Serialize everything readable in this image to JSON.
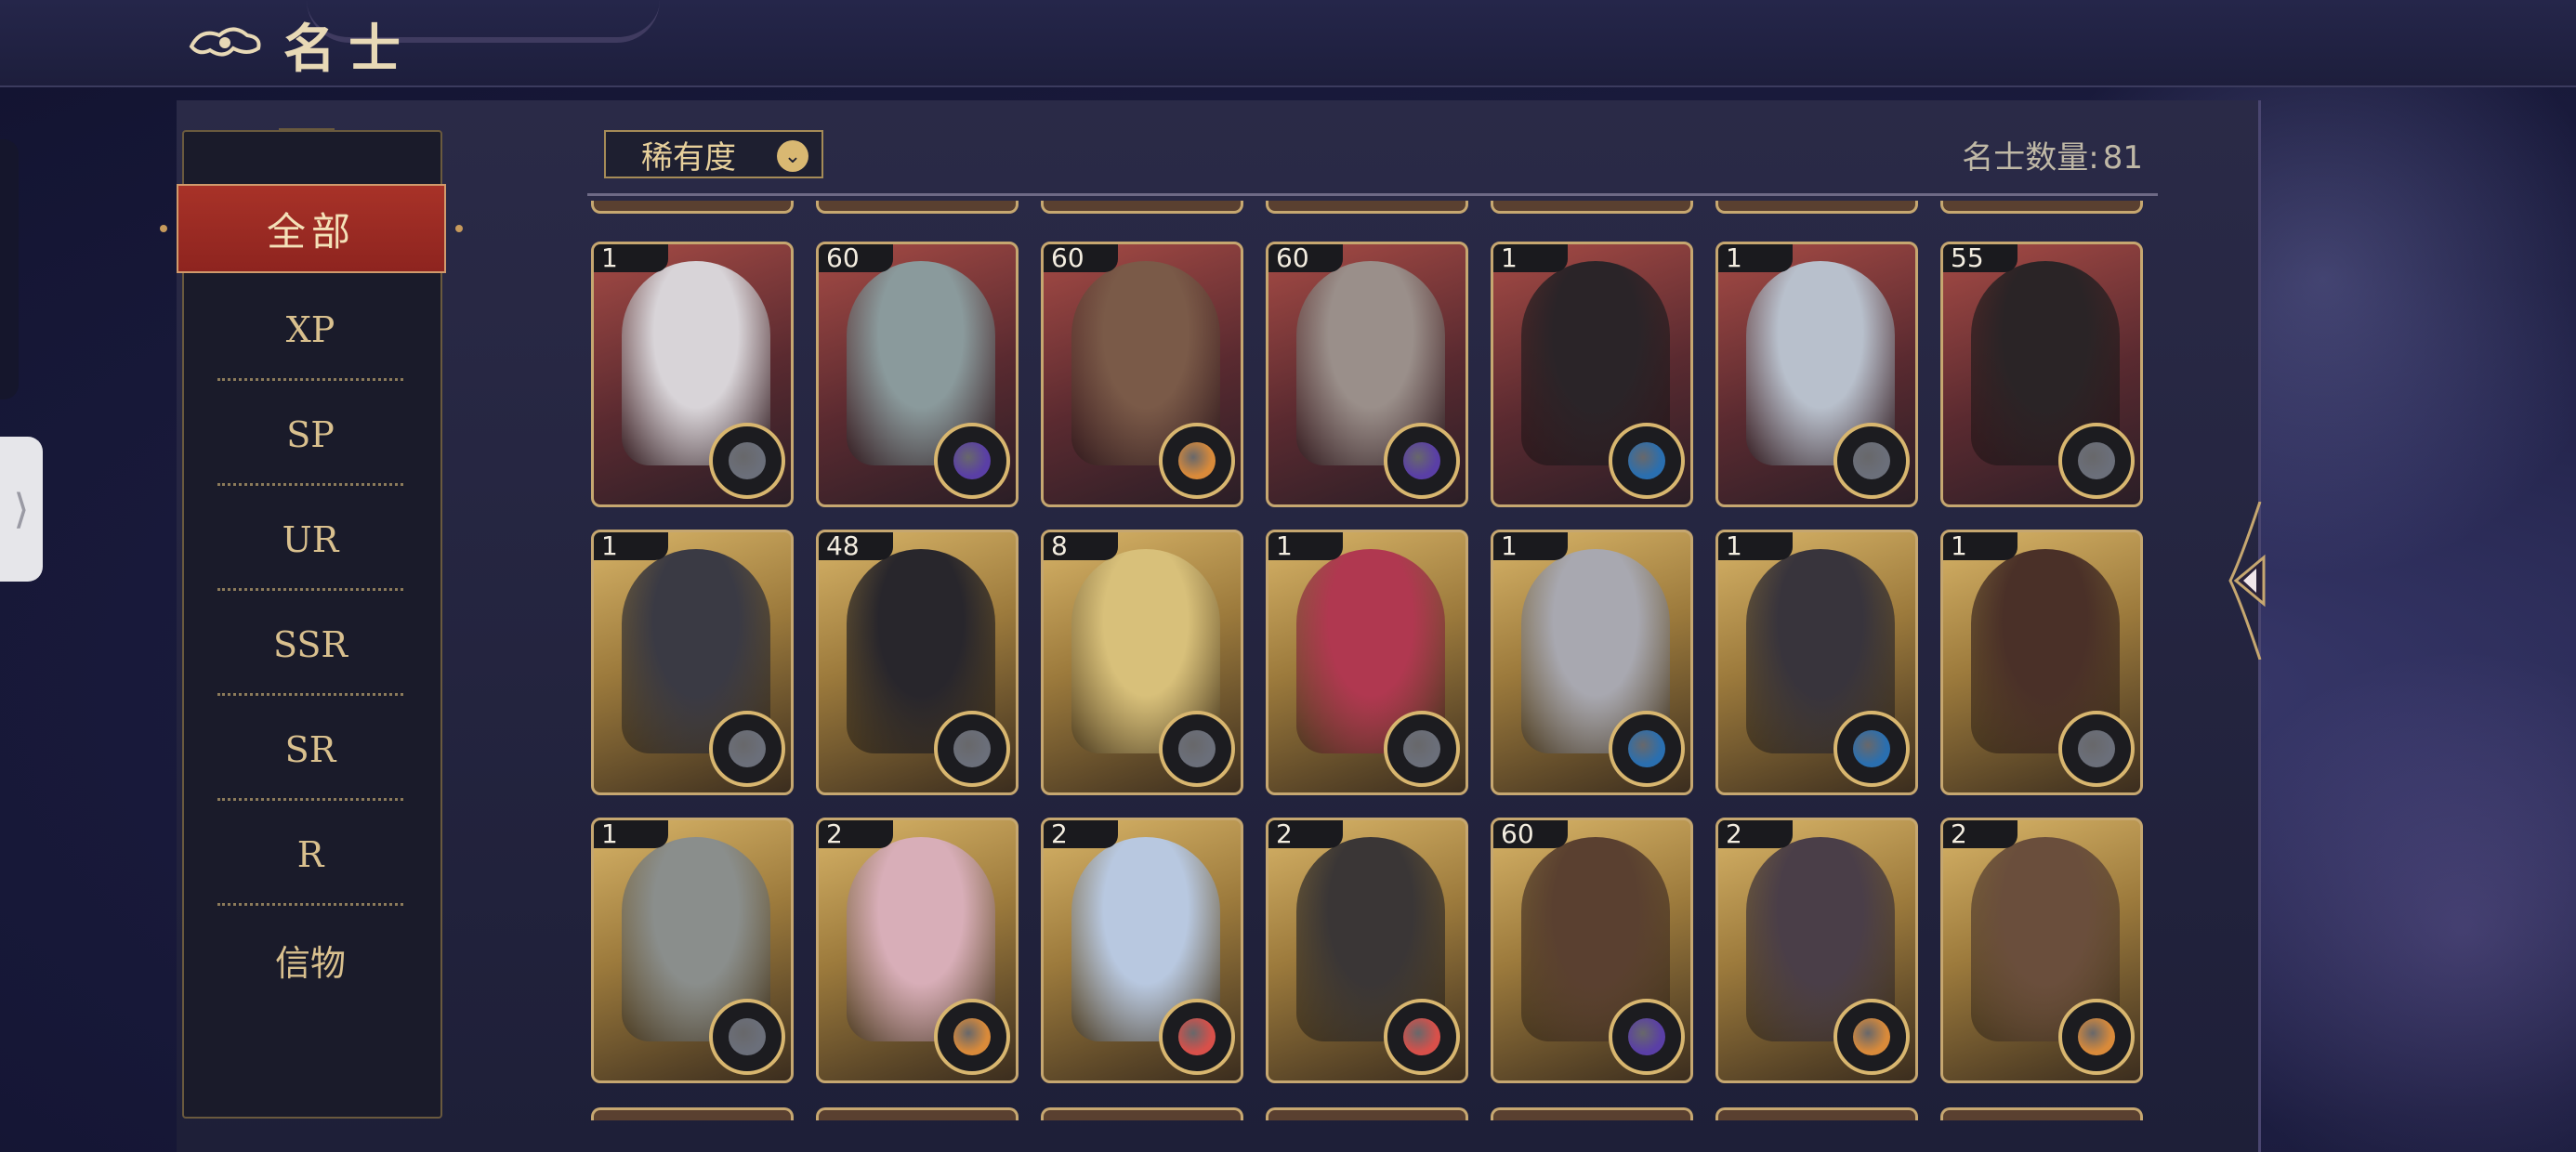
{
  "title": "名士",
  "sidebar": {
    "active": "全部",
    "items": [
      "XP",
      "SP",
      "UR",
      "SSR",
      "SR",
      "R",
      "信物"
    ]
  },
  "sort": {
    "label": "稀有度"
  },
  "count": {
    "label": "名士数量:",
    "value": "81"
  },
  "colors": {
    "accent": "#a83228",
    "gold": "#c6a770",
    "panel": "#1a1b2a"
  },
  "cards": [
    {
      "level": "1",
      "frame": "red",
      "element": "grey",
      "color": "#6b6f7a"
    },
    {
      "level": "60",
      "frame": "red",
      "element": "purple",
      "color": "#5a3fa6"
    },
    {
      "level": "60",
      "frame": "red",
      "element": "orange",
      "color": "#d98a3a"
    },
    {
      "level": "60",
      "frame": "red",
      "element": "purple",
      "color": "#5a3fa6"
    },
    {
      "level": "1",
      "frame": "red",
      "element": "blue",
      "color": "#2a6fb0"
    },
    {
      "level": "1",
      "frame": "red",
      "element": "grey",
      "color": "#6b6f7a"
    },
    {
      "level": "55",
      "frame": "red",
      "element": "grey",
      "color": "#6b6f7a"
    },
    {
      "level": "1",
      "frame": "gold",
      "element": "grey",
      "color": "#6b6f7a"
    },
    {
      "level": "48",
      "frame": "gold",
      "element": "grey",
      "color": "#6b6f7a"
    },
    {
      "level": "8",
      "frame": "gold",
      "element": "grey",
      "color": "#6b6f7a"
    },
    {
      "level": "1",
      "frame": "gold",
      "element": "grey",
      "color": "#6b6f7a"
    },
    {
      "level": "1",
      "frame": "gold",
      "element": "blue",
      "color": "#2a6fb0"
    },
    {
      "level": "1",
      "frame": "gold",
      "element": "blue",
      "color": "#2a6fb0"
    },
    {
      "level": "1",
      "frame": "gold",
      "element": "grey",
      "color": "#6b6f7a"
    },
    {
      "level": "1",
      "frame": "gold",
      "element": "grey",
      "color": "#6b6f7a"
    },
    {
      "level": "2",
      "frame": "gold",
      "element": "orange",
      "color": "#d98a3a"
    },
    {
      "level": "2",
      "frame": "gold",
      "element": "red",
      "color": "#d8504a"
    },
    {
      "level": "2",
      "frame": "gold",
      "element": "red",
      "color": "#d8504a"
    },
    {
      "level": "60",
      "frame": "gold",
      "element": "purple",
      "color": "#5a3fa6"
    },
    {
      "level": "2",
      "frame": "gold",
      "element": "orange",
      "color": "#d98a3a"
    },
    {
      "level": "2",
      "frame": "gold",
      "element": "orange",
      "color": "#d98a3a"
    }
  ]
}
